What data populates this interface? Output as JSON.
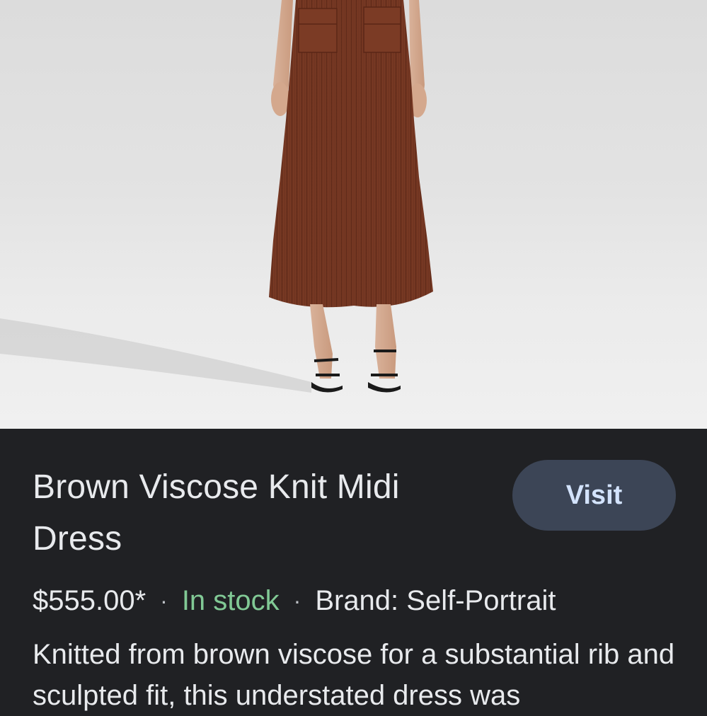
{
  "product": {
    "image_alt": "Model wearing brown ribbed knit midi dress",
    "title": "Brown Viscose Knit Midi Dress",
    "visit_label": "Visit",
    "price": "$555.00*",
    "separator": "·",
    "stock_status": "In stock",
    "brand": "Brand: Self-Portrait",
    "description": "Knitted from brown viscose for a substantial rib and sculpted fit, this understated dress was"
  },
  "colors": {
    "background": "#202124",
    "text": "#e8eaed",
    "stock": "#81c995",
    "button_bg": "#3c4556",
    "button_text": "#d3e3fd",
    "dress": "#7a3a24"
  }
}
